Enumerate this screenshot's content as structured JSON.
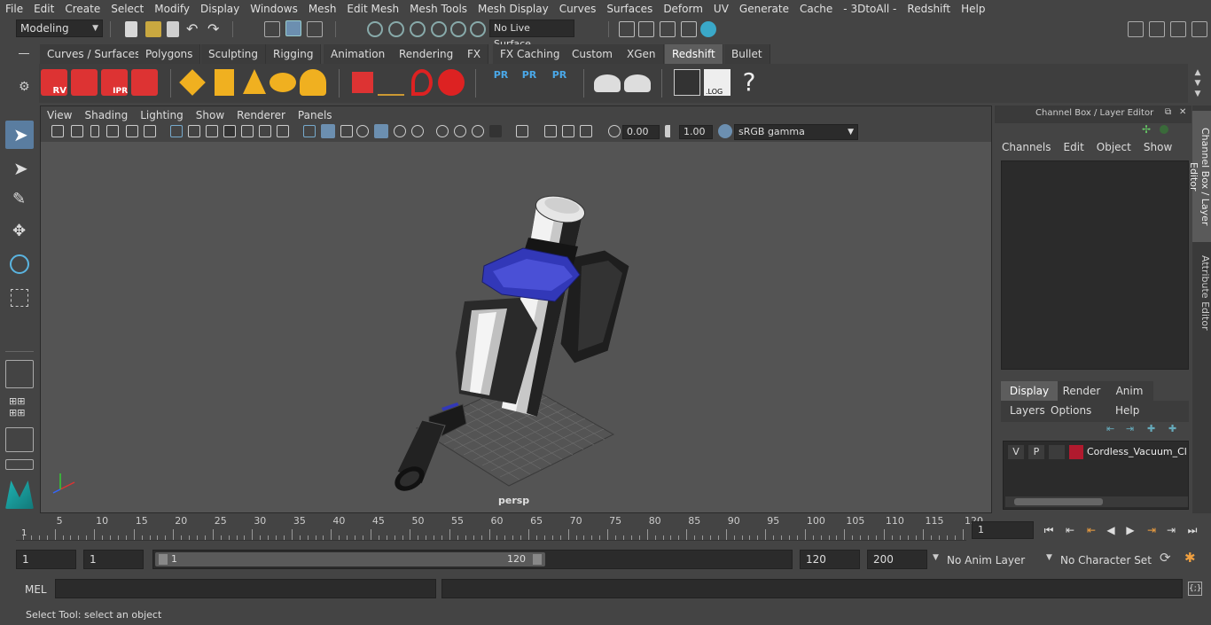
{
  "menubar": {
    "items": [
      "File",
      "Edit",
      "Create",
      "Select",
      "Modify",
      "Display",
      "Windows",
      "Mesh",
      "Edit Mesh",
      "Mesh Tools",
      "Mesh Display",
      "Curves",
      "Surfaces",
      "Deform",
      "UV",
      "Generate",
      "Cache",
      "- 3DtoAll -",
      "Redshift",
      "Help"
    ]
  },
  "statusline": {
    "mode": "Modeling",
    "live_surface": "No Live Surface"
  },
  "shelf": {
    "tabs": [
      "Curves / Surfaces",
      "Polygons",
      "Sculpting",
      "Rigging",
      "Animation",
      "Rendering",
      "FX",
      "FX Caching",
      "Custom",
      "XGen",
      "Redshift",
      "Bullet"
    ],
    "active_tab": "Redshift",
    "labels": {
      "rv": "RV",
      "ipr": "IPR",
      "pr": "PR",
      "log": ".LOG",
      "help": "?"
    }
  },
  "viewport": {
    "menu": [
      "View",
      "Shading",
      "Lighting",
      "Show",
      "Renderer",
      "Panels"
    ],
    "exposure": "0.00",
    "gamma": "1.00",
    "color_space": "sRGB gamma",
    "camera_label": "persp"
  },
  "channel_box": {
    "title": "Channel Box / Layer Editor",
    "menu": [
      "Channels",
      "Edit",
      "Object",
      "Show"
    ],
    "layer_tabs": [
      "Display",
      "Render",
      "Anim"
    ],
    "layer_menu": [
      "Layers",
      "Options",
      "Help"
    ],
    "layer": {
      "v": "V",
      "p": "P",
      "name": "Cordless_Vacuum_Clea",
      "color": "#b01a2e"
    }
  },
  "side_tabs": [
    "Channel Box / Layer Editor",
    "Attribute Editor"
  ],
  "timeline": {
    "ticks": [
      5,
      10,
      15,
      20,
      25,
      30,
      35,
      40,
      45,
      50,
      55,
      60,
      65,
      70,
      75,
      80,
      85,
      90,
      95,
      100,
      105,
      110,
      115,
      120
    ],
    "start_label": "1",
    "current_frame": "1"
  },
  "range": {
    "start": "1",
    "playback_start": "1",
    "slider_start": "1",
    "slider_end": "120",
    "playback_end": "120",
    "end": "200",
    "anim_layer": "No Anim Layer",
    "char_set": "No Character Set"
  },
  "cmdline": {
    "lang": "MEL"
  },
  "helpline": {
    "text": "Select Tool: select an object"
  }
}
